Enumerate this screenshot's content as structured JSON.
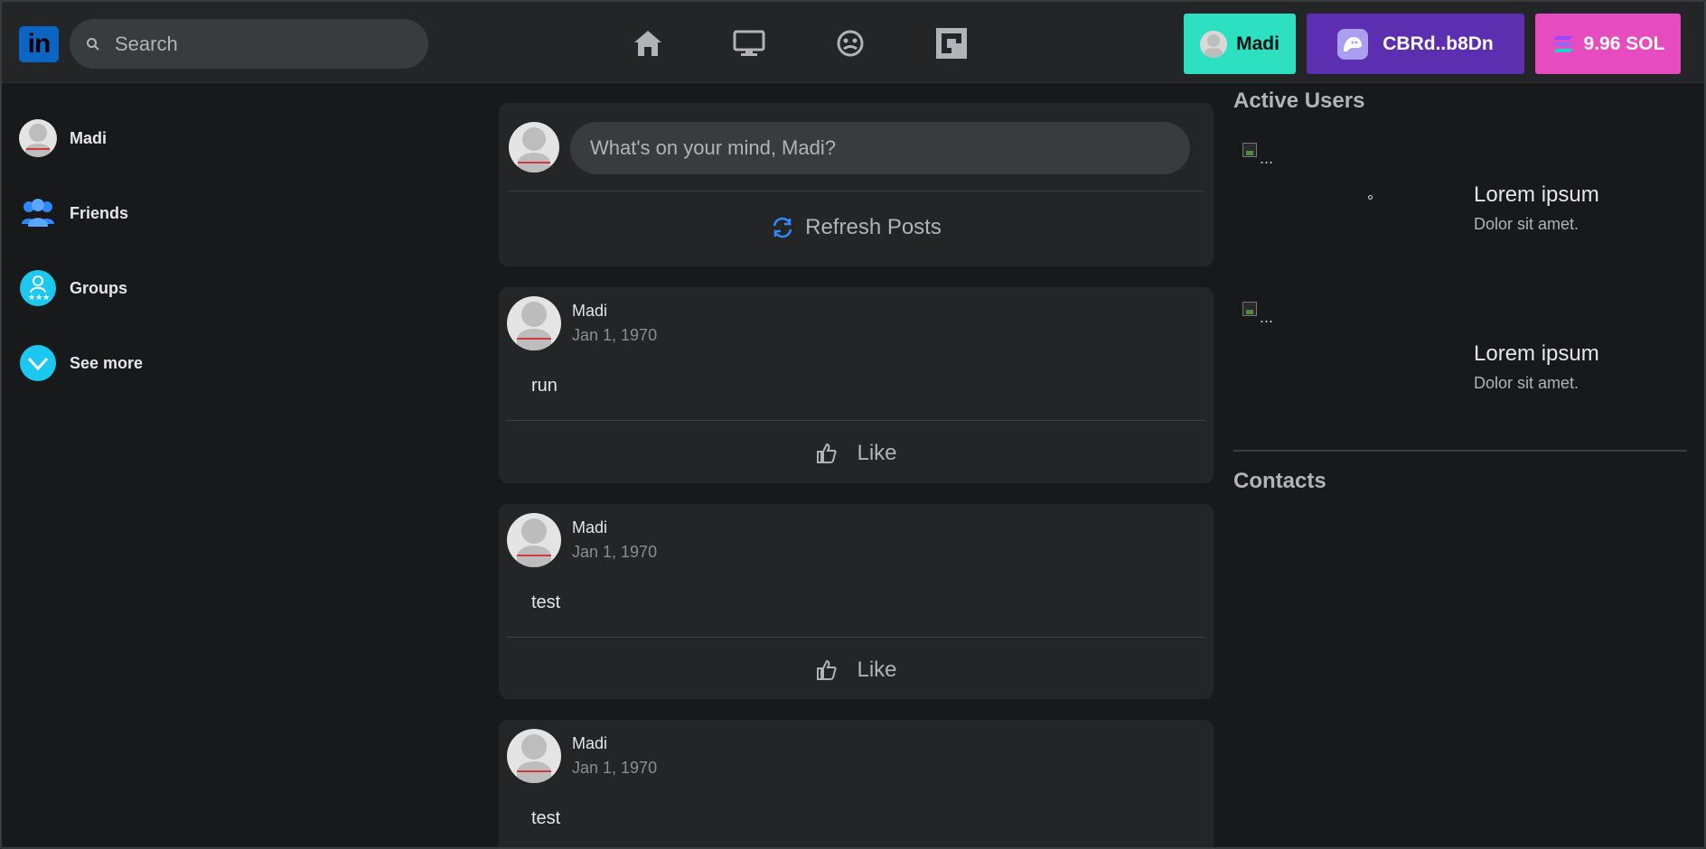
{
  "header": {
    "logo_text": "in",
    "search_placeholder": "Search",
    "nav": [
      {
        "icon": "home-icon"
      },
      {
        "icon": "monitor-icon"
      },
      {
        "icon": "emoji-icon"
      },
      {
        "icon": "square-logo-icon"
      }
    ],
    "user_pill_label": "Madi",
    "wallet_label": "CBRd..b8Dn",
    "sol_label": "9.96 SOL",
    "colors": {
      "user_pill": "#2de0c1",
      "wallet_pill": "#5b2fb0",
      "sol_pill": "#e64bc0"
    }
  },
  "sidebar": {
    "items": [
      {
        "label": "Madi",
        "icon": "avatar"
      },
      {
        "label": "Friends",
        "icon": "friends-icon"
      },
      {
        "label": "Groups",
        "icon": "groups-icon"
      },
      {
        "label": "See more",
        "icon": "chevron-down-icon"
      }
    ]
  },
  "composer": {
    "placeholder": "What's on your mind, Madi?",
    "refresh_label": "Refresh Posts"
  },
  "posts": [
    {
      "author": "Madi",
      "date": "Jan 1, 1970",
      "text": "run",
      "like_label": "Like"
    },
    {
      "author": "Madi",
      "date": "Jan 1, 1970",
      "text": "test",
      "like_label": "Like"
    },
    {
      "author": "Madi",
      "date": "Jan 1, 1970",
      "text": "test"
    }
  ],
  "right": {
    "active_title": "Active Users",
    "active_users": [
      {
        "img_alt": "...",
        "name": "Lorem ipsum",
        "sub": "Dolor sit amet."
      },
      {
        "img_alt": "...",
        "name": "Lorem ipsum",
        "sub": "Dolor sit amet."
      }
    ],
    "contacts_title": "Contacts"
  }
}
